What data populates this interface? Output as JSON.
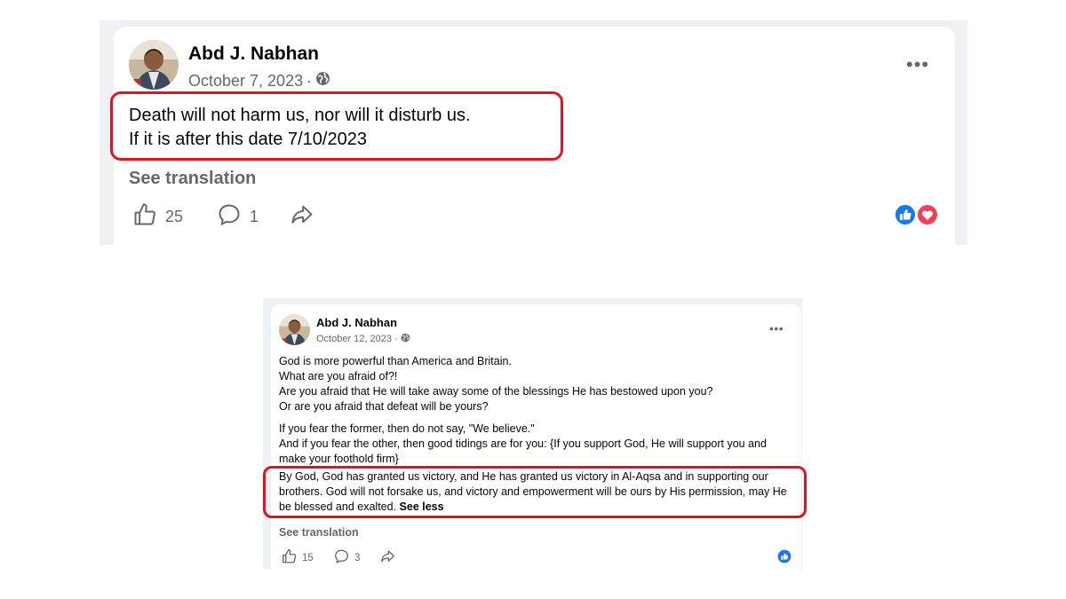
{
  "post1": {
    "author": "Abd J. Nabhan",
    "date": "October 7, 2023",
    "separator": "·",
    "text_line1": "Death will not harm us, nor will it disturb us.",
    "text_line2": "If it is after this date 7/10/2023",
    "see_translation": "See translation",
    "likes": "25",
    "comments": "1",
    "reactions": [
      "like-icon",
      "love-icon"
    ]
  },
  "post2": {
    "author": "Abd J. Nabhan",
    "date": "October 12, 2023",
    "separator": "·",
    "para1": [
      "God is more powerful than America and Britain.",
      "What are you afraid of?!",
      "Are you afraid that He will take away some of the blessings He has bestowed upon you?",
      "Or are you afraid that defeat will be yours?"
    ],
    "para2": [
      "If you fear the former, then do not say, \"We believe.\"",
      "And if you fear the other, then good tidings are for you: {If you support God, He will support you and make your foothold firm}"
    ],
    "para3": "By God, God has granted us victory, and He has granted us victory in Al-Aqsa and in supporting our brothers. God will not forsake us, and victory and empowerment will be ours by His permission, may He be blessed and exalted.",
    "see_less": "See less",
    "see_translation": "See translation",
    "likes": "15",
    "comments": "3",
    "reactions": [
      "like-icon"
    ]
  },
  "colors": {
    "highlight": "#e0141e",
    "facebook_blue": "#1877f2",
    "love_red": "#f33e58",
    "secondary_text": "#65676b"
  }
}
